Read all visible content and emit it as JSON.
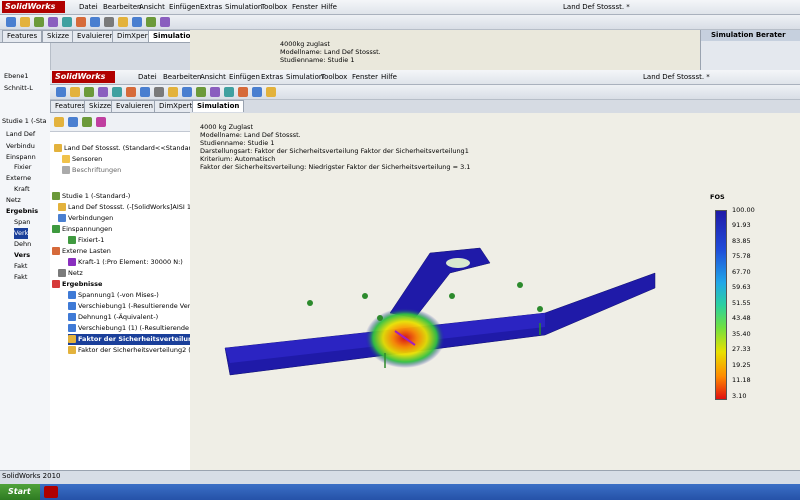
{
  "app": {
    "logo": "SolidWorks",
    "title": "Land Def Stossst. *",
    "status": "SolidWorks 2010"
  },
  "menu": [
    "Datei",
    "Bearbeiten",
    "Ansicht",
    "Einfügen",
    "Extras",
    "Simulation",
    "Toolbox",
    "Fenster",
    "Hilfe"
  ],
  "tabs": [
    "Features",
    "Skizze",
    "Evaluieren",
    "DimXpert",
    "Simulation"
  ],
  "back_tabs": [
    "Features",
    "Skizze",
    "Evaluieren",
    "DimXpert",
    "Simulation"
  ],
  "sim_advisor": "Simulation Berater",
  "back_info": [
    "4000kg zuglast",
    "Modellname: Land Def Stossst.",
    "Studienname: Studie 1"
  ],
  "back_tree": [
    "Ebene1",
    "Schnitt-L",
    "Studie 1 (-Sta",
    "Land Def",
    "Verbindu",
    "Einspann",
    "Fixier",
    "Externe",
    "Kraft",
    "Netz",
    "Ergebnis",
    "Span",
    "Verk",
    "Dehn",
    "Vers",
    "Fakt",
    "Fakt"
  ],
  "tree": {
    "part": "Land Def Stossst.  (Standard<<Standard>_Ar",
    "sensors": "Sensoren",
    "annotations": "Beschriftungen",
    "study": "Studie 1 (-Standard-)",
    "body": "Land Def Stossst. (-[SolidWorks]AISI 1015 St",
    "connections": "Verbindungen",
    "fixtures": "Einspannungen",
    "fixed": "Fixiert-1",
    "loads": "Externe Lasten",
    "force": "Kraft-1 (:Pro Element: 30000 N:)",
    "mesh": "Netz",
    "results": "Ergebnisse",
    "r1": "Spannung1 (-von Mises-)",
    "r2": "Verschiebung1 (-Resultierende Verschiebu",
    "r3": "Dehnung1 (-Äquivalent-)",
    "r4": "Verschiebung1 (1) (-Resultierende Versch",
    "r5": "Faktor der Sicherheitsverteilung1 (",
    "r6": "Faktor der Sicherheitsverteilung2 (-Autom"
  },
  "info": [
    "4000 kg Zuglast",
    "Modellname: Land Def Stossst.",
    "Studienname: Studie 1",
    "Darstellungsart: Faktor der Sicherheitsverteilung Faktor der Sicherheitsverteilung1",
    "Kriterium: Automatisch",
    "Faktor der Sicherheitsverteilung: Niedrigster Faktor der Sicherheitsverteilung = 3.1"
  ],
  "legend": {
    "title": "FOS",
    "ticks": [
      "100.00",
      "91.93",
      "83.85",
      "75.78",
      "67.70",
      "59.63",
      "51.55",
      "43.48",
      "35.40",
      "27.33",
      "19.25",
      "11.18",
      "3.10"
    ]
  },
  "taskbar": {
    "start": "Start"
  },
  "colors": {
    "model": "#1f1aa8",
    "hot": "#e01010",
    "accent": "#2552a8"
  }
}
